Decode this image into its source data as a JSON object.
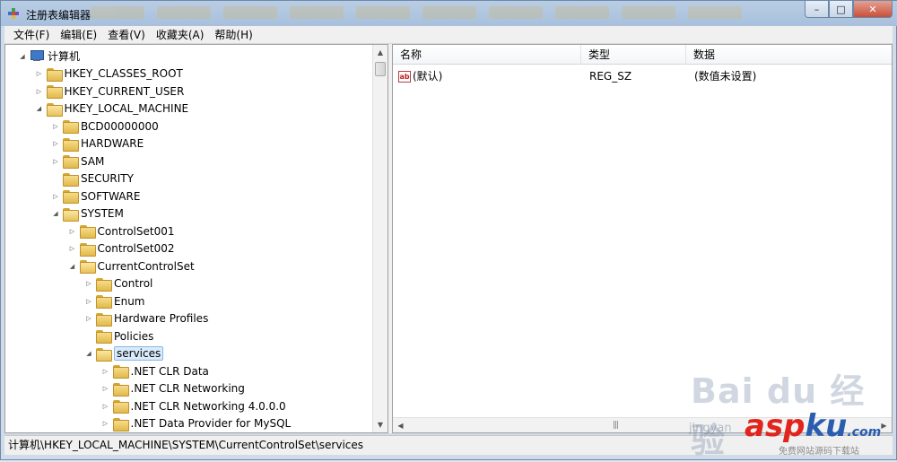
{
  "window": {
    "title": "注册表编辑器",
    "controls": {
      "minimize": "–",
      "maximize": "□",
      "close": "✕"
    }
  },
  "menu": [
    "文件(F)",
    "编辑(E)",
    "查看(V)",
    "收藏夹(A)",
    "帮助(H)"
  ],
  "tree": [
    {
      "label": "计算机",
      "level": 0,
      "icon": "computer-icon",
      "expanded": true
    },
    {
      "label": "HKEY_CLASSES_ROOT",
      "level": 1,
      "expanded": false
    },
    {
      "label": "HKEY_CURRENT_USER",
      "level": 1,
      "expanded": false
    },
    {
      "label": "HKEY_LOCAL_MACHINE",
      "level": 1,
      "expanded": true
    },
    {
      "label": "BCD00000000",
      "level": 2,
      "expanded": false
    },
    {
      "label": "HARDWARE",
      "level": 2,
      "expanded": false
    },
    {
      "label": "SAM",
      "level": 2,
      "expanded": false
    },
    {
      "label": "SECURITY",
      "level": 2,
      "expanded": null
    },
    {
      "label": "SOFTWARE",
      "level": 2,
      "expanded": false
    },
    {
      "label": "SYSTEM",
      "level": 2,
      "expanded": true
    },
    {
      "label": "ControlSet001",
      "level": 3,
      "expanded": false
    },
    {
      "label": "ControlSet002",
      "level": 3,
      "expanded": false
    },
    {
      "label": "CurrentControlSet",
      "level": 3,
      "expanded": true
    },
    {
      "label": "Control",
      "level": 4,
      "expanded": false
    },
    {
      "label": "Enum",
      "level": 4,
      "expanded": false
    },
    {
      "label": "Hardware Profiles",
      "level": 4,
      "expanded": false
    },
    {
      "label": "Policies",
      "level": 4,
      "expanded": null
    },
    {
      "label": "services",
      "level": 4,
      "expanded": true,
      "selected": true
    },
    {
      "label": ".NET CLR Data",
      "level": 5,
      "expanded": false
    },
    {
      "label": ".NET CLR Networking",
      "level": 5,
      "expanded": false
    },
    {
      "label": ".NET CLR Networking 4.0.0.0",
      "level": 5,
      "expanded": false
    },
    {
      "label": ".NET Data Provider for MySQL",
      "level": 5,
      "expanded": false
    }
  ],
  "list": {
    "columns": [
      "名称",
      "类型",
      "数据"
    ],
    "rows": [
      {
        "name": "(默认)",
        "type": "REG_SZ",
        "data": "(数值未设置)",
        "icon": "string-value-icon",
        "icon_text": "ab"
      }
    ]
  },
  "status": {
    "path": "计算机\\HKEY_LOCAL_MACHINE\\SYSTEM\\CurrentControlSet\\services"
  },
  "watermarks": {
    "baidu": "Bai du 经验",
    "jingyan": "jingyan",
    "asp": "asp",
    "ku": "ku",
    "com": ".com",
    "sub": "免费网站源码下载站"
  },
  "colors": {
    "selection": "#d9ebfb",
    "folder": "#e2b94b",
    "accent_red": "#e2241c"
  }
}
